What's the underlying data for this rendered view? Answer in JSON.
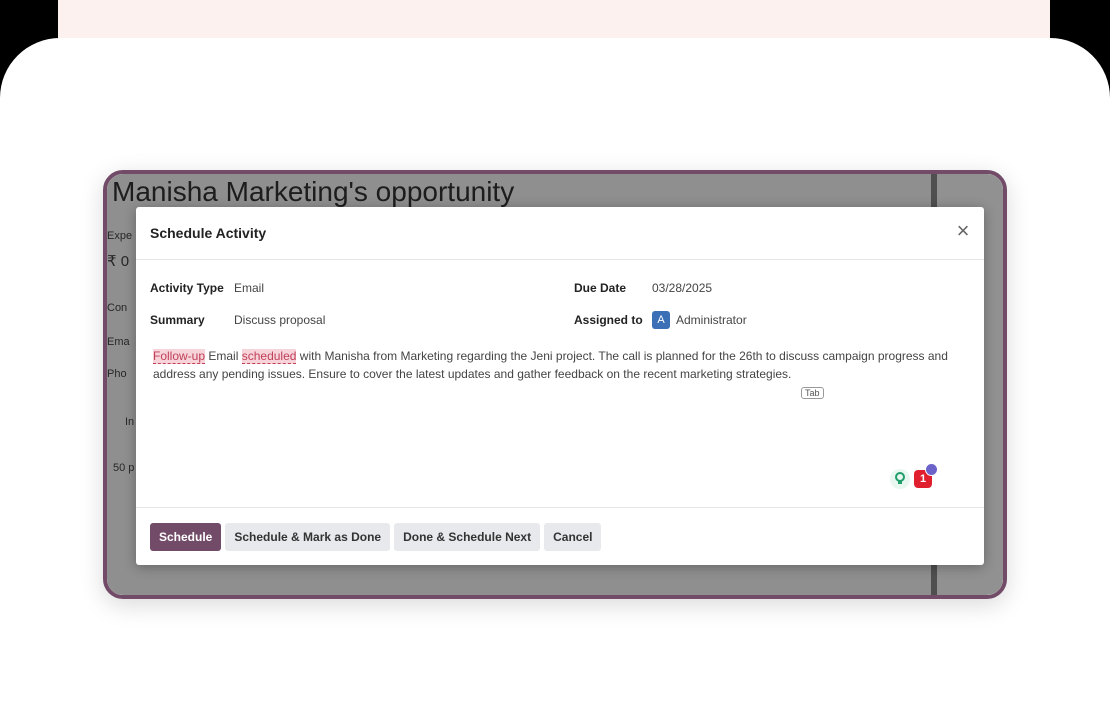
{
  "background": {
    "title": "Manisha Marketing's opportunity",
    "side_labels": [
      "Expe",
      "₹ 0",
      "Con",
      "Ema",
      "Pho",
      "In",
      "50 p"
    ]
  },
  "modal": {
    "title": "Schedule Activity",
    "close_icon": "close-icon",
    "fields": {
      "activity_type_label": "Activity Type",
      "activity_type_value": "Email",
      "summary_label": "Summary",
      "summary_value": "Discuss proposal",
      "due_date_label": "Due Date",
      "due_date_value": "03/28/2025",
      "assigned_to_label": "Assigned to",
      "assigned_avatar": "A",
      "assigned_to_value": "Administrator"
    },
    "note": {
      "word1": "Follow-up",
      "text1": " Email ",
      "word2": "scheduled",
      "text2": " with Manisha from Marketing regarding the Jeni project. The call is planned for the 26th to discuss campaign progress and address any pending issues. Ensure to cover the latest updates and gather feedback on the recent marketing strategies."
    },
    "tab_hint": "Tab",
    "badge_count": "1",
    "buttons": {
      "schedule": "Schedule",
      "schedule_mark_done": "Schedule & Mark as Done",
      "done_schedule_next": "Done & Schedule Next",
      "cancel": "Cancel"
    }
  },
  "colors": {
    "brand": "#714b67",
    "avatar": "#3b6fb6",
    "highlight": "#f7d4d9"
  }
}
